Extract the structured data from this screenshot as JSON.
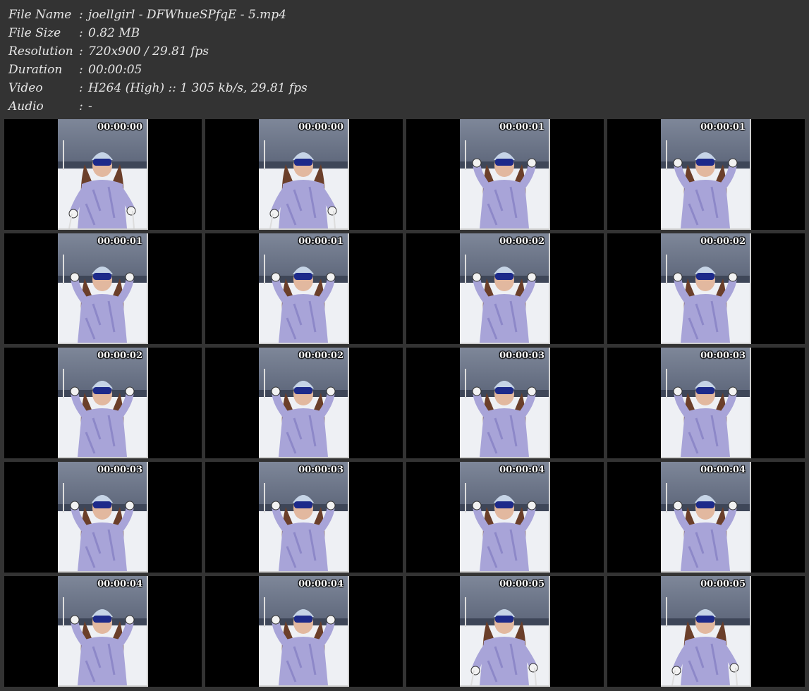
{
  "info": [
    {
      "label": "File Name",
      "sep": ":",
      "value": "joellgirl - DFWhueSPfqE - 5.mp4"
    },
    {
      "label": "File Size",
      "sep": ":",
      "value": "0.82 MB"
    },
    {
      "label": "Resolution",
      "sep": ":",
      "value": "720x900 / 29.81 fps"
    },
    {
      "label": "Duration",
      "sep": ":",
      "value": "00:00:05"
    },
    {
      "label": "Video",
      "sep": ":",
      "value": "H264 (High) :: 1 305 kb/s, 29.81 fps"
    },
    {
      "label": "Audio",
      "sep": ":",
      "value": "-"
    }
  ],
  "thumbnails": [
    {
      "timestamp": "00:00:00"
    },
    {
      "timestamp": "00:00:00"
    },
    {
      "timestamp": "00:00:01"
    },
    {
      "timestamp": "00:00:01"
    },
    {
      "timestamp": "00:00:01"
    },
    {
      "timestamp": "00:00:01"
    },
    {
      "timestamp": "00:00:02"
    },
    {
      "timestamp": "00:00:02"
    },
    {
      "timestamp": "00:00:02"
    },
    {
      "timestamp": "00:00:02"
    },
    {
      "timestamp": "00:00:03"
    },
    {
      "timestamp": "00:00:03"
    },
    {
      "timestamp": "00:00:03"
    },
    {
      "timestamp": "00:00:03"
    },
    {
      "timestamp": "00:00:04"
    },
    {
      "timestamp": "00:00:04"
    },
    {
      "timestamp": "00:00:04"
    },
    {
      "timestamp": "00:00:04"
    },
    {
      "timestamp": "00:00:05"
    },
    {
      "timestamp": "00:00:05"
    }
  ],
  "colors": {
    "background": "#333333",
    "cell": "#000000",
    "sky": "#5b6478",
    "snow": "#eef0f4",
    "jacket": "#a8a4d8",
    "helmet": "#c6d4e6"
  }
}
